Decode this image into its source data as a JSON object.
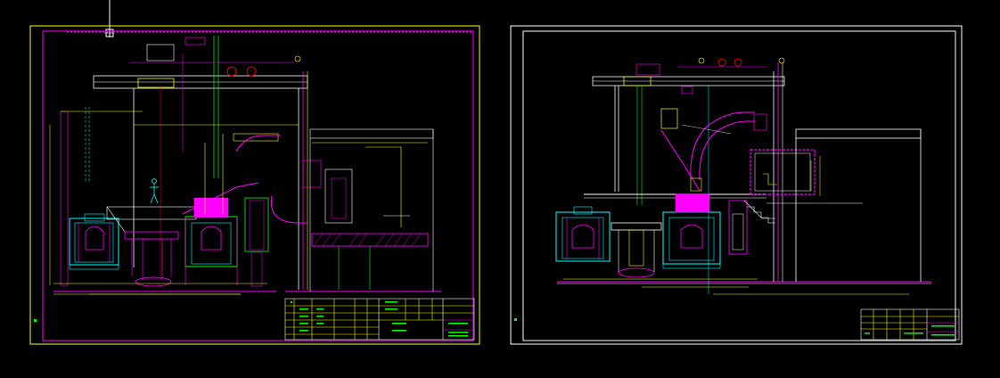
{
  "app": {
    "title": ""
  },
  "colors": {
    "background": "#000000",
    "frame": "#ffff00",
    "magenta": "#ff00ff",
    "cyan": "#00ffff",
    "green": "#00ff00",
    "white": "#ffffff",
    "yellow": "#ffff00",
    "red": "#ff0000"
  },
  "sheets": [
    {
      "name": "left-sheet"
    },
    {
      "name": "right-sheet"
    }
  ],
  "icons": [
    "crosshair-cursor-icon",
    "ucs-marker-icon"
  ]
}
